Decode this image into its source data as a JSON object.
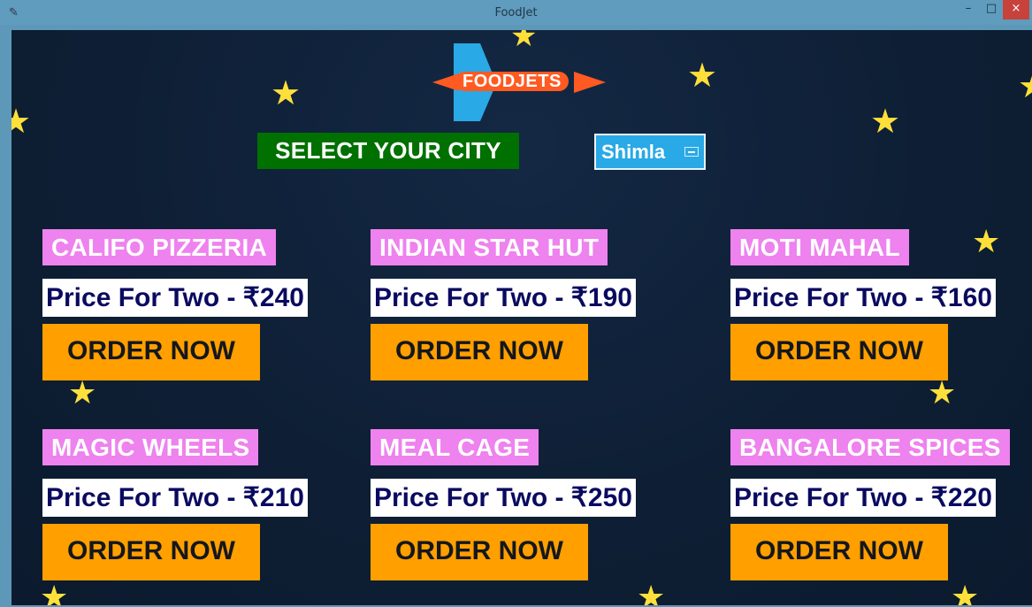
{
  "window": {
    "title": "FoodJet",
    "app_icon": "feather-icon",
    "minimize": "–",
    "maximize": "□",
    "close": "×"
  },
  "logo": {
    "text": "FOODJETS",
    "icon": "jet-icon"
  },
  "city": {
    "label": "SELECT YOUR CITY",
    "selected": "Shimla"
  },
  "restaurants": [
    {
      "name": "CALIFO PIZZERIA",
      "price": "Price For Two - ₹240",
      "button": "ORDER NOW"
    },
    {
      "name": "INDIAN STAR HUT",
      "price": "Price For Two - ₹190",
      "button": "ORDER NOW"
    },
    {
      "name": "MOTI MAHAL",
      "price": "Price For Two - ₹160",
      "button": "ORDER NOW"
    },
    {
      "name": "MAGIC WHEELS",
      "price": "Price For Two - ₹210",
      "button": "ORDER NOW"
    },
    {
      "name": "MEAL CAGE",
      "price": "Price For Two - ₹250",
      "button": "ORDER NOW"
    },
    {
      "name": "BANGALORE SPICES",
      "price": "Price For Two - ₹220",
      "button": "ORDER NOW"
    }
  ],
  "colors": {
    "background": "#0e1f35",
    "name_label": "#ee82ee",
    "order_button": "#ff9f00",
    "select_label": "#007000",
    "city_dropdown": "#29a9e6",
    "stars": "#ffe03a"
  }
}
